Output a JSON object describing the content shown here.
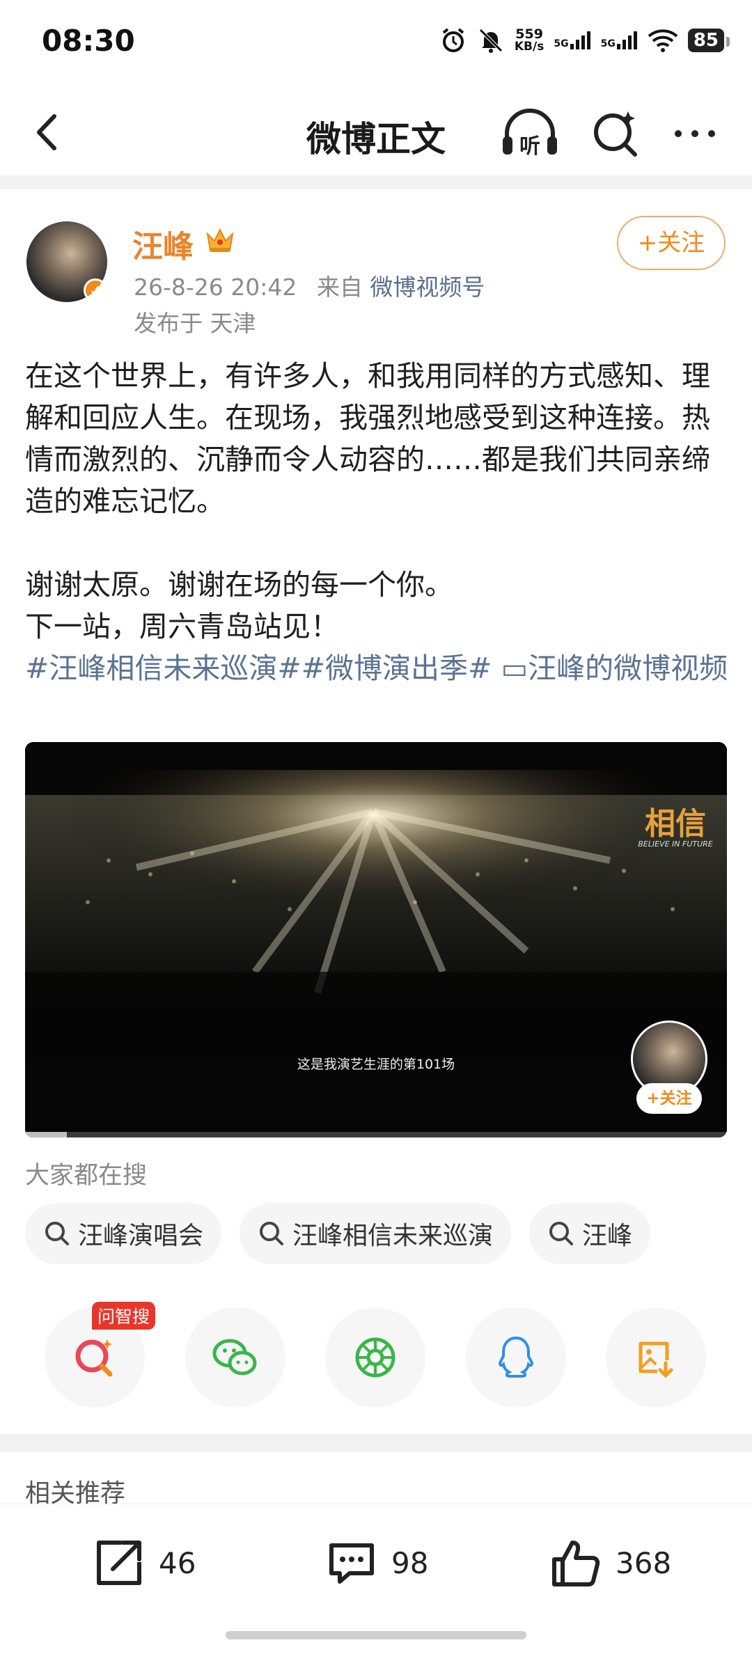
{
  "status_bar": {
    "time": "08:30",
    "net_speed_value": "559",
    "net_speed_unit": "KB/s",
    "signal1": "5G",
    "signal2": "5G",
    "battery": "85"
  },
  "nav": {
    "title": "微博正文",
    "listen_label": "听"
  },
  "post": {
    "author": "汪峰",
    "timestamp": "26-8-26 20:42",
    "source_prefix": "来自",
    "source": "微博视频号",
    "location": "发布于 天津",
    "follow_label": "+关注",
    "paragraph1": "在这个世界上，有许多人，和我用同样的方式感知、理解和回应人生。在现场，我强烈地感受到这种连接。热情而激烈的、沉静而令人动容的……都是我们共同亲缔造的难忘记忆。",
    "line2": "谢谢太原。谢谢在场的每一个你。",
    "line3": "下一站，周六青岛站见！",
    "tags": "#汪峰相信未来巡演##微博演出季# ▭汪峰的微博视频"
  },
  "video": {
    "brand_text": "相信",
    "brand_subtitle": "BELIEVE IN FUTURE",
    "subtitle": "这是我演艺生涯的第101场",
    "follow_label": "+关注",
    "progress": 0.06
  },
  "hot_search": {
    "title": "大家都在搜",
    "items": [
      "汪峰演唱会",
      "汪峰相信未来巡演",
      "汪峰"
    ]
  },
  "share": {
    "badge": "问智搜",
    "items": [
      "search-ai-icon",
      "wechat-icon",
      "moments-icon",
      "qq-icon",
      "save-image-icon"
    ]
  },
  "related_title": "相关推荐",
  "actions": {
    "repost_count": "46",
    "comment_count": "98",
    "like_count": "368"
  },
  "colors": {
    "accent": "#f08a1b",
    "link": "#5a7394"
  }
}
